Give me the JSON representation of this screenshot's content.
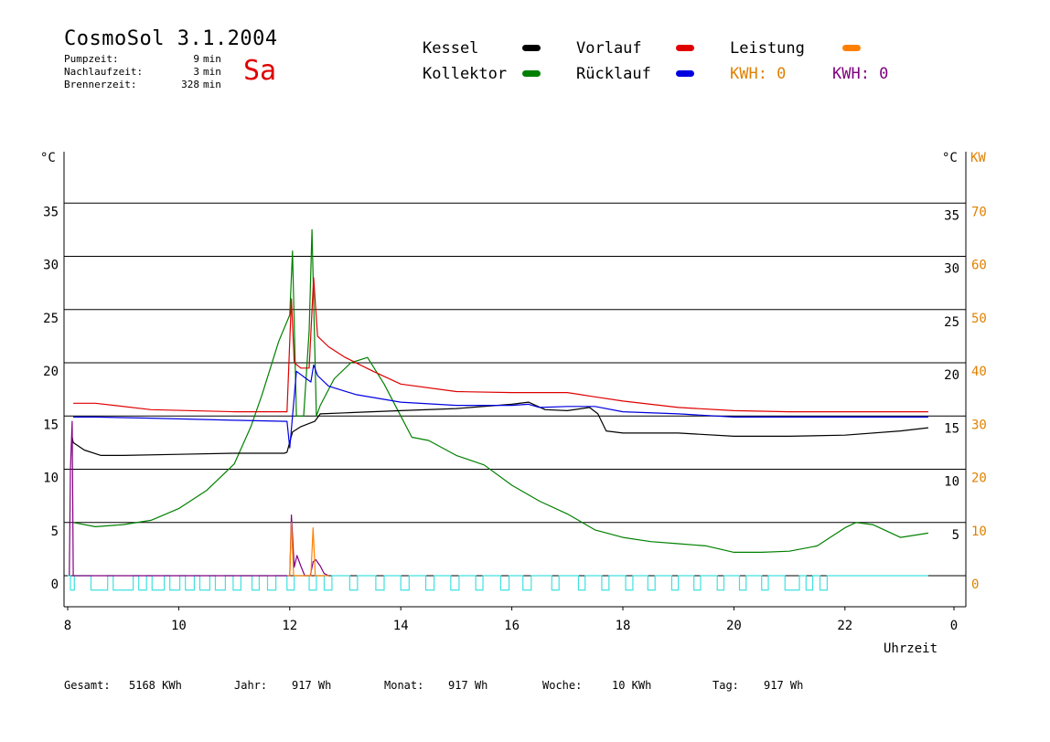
{
  "header": {
    "title": "CosmoSol 3.1.2004",
    "day": "Sa",
    "stats": [
      {
        "label": "Pumpzeit:",
        "value": "9",
        "unit": "min"
      },
      {
        "label": "Nachlaufzeit:",
        "value": "3",
        "unit": "min"
      },
      {
        "label": "Brennerzeit:",
        "value": "328",
        "unit": "min"
      }
    ]
  },
  "legend": {
    "kessel": "Kessel",
    "vorlauf": "Vorlauf",
    "leistung": "Leistung",
    "kollektor": "Kollektor",
    "ruecklauf": "Rücklauf",
    "kwh_orange": "KWH: 0",
    "kwh_purple": "KWH: 0"
  },
  "colors": {
    "kessel": "#000000",
    "vorlauf": "#e00000",
    "leistung": "#ff8000",
    "kollektor": "#008000",
    "ruecklauf": "#0000e0",
    "kwh_purple": "#800080",
    "pump": "#40e0e0",
    "axis_right_kw": "#e08000"
  },
  "axes": {
    "left_unit": "°C",
    "right_unit": "°C",
    "right_unit2": "KW",
    "xlabel": "Uhrzeit"
  },
  "footer": [
    {
      "label": "Gesamt:",
      "value": "5168 KWh"
    },
    {
      "label": "Jahr:",
      "value": "917 Wh"
    },
    {
      "label": "Monat:",
      "value": "917 Wh"
    },
    {
      "label": "Woche:",
      "value": "10 KWh"
    },
    {
      "label": "Tag:",
      "value": "917 Wh"
    }
  ],
  "chart_data": {
    "type": "line",
    "xlabel": "Uhrzeit",
    "ylabel": "°C",
    "xlim": [
      8,
      24
    ],
    "ylim": [
      0,
      40
    ],
    "y2lim": [
      0,
      80
    ],
    "y2label": "KW",
    "x_ticks": [
      "8",
      "10",
      "12",
      "14",
      "16",
      "18",
      "20",
      "22",
      "0"
    ],
    "y_ticks_left": [
      "0",
      "5",
      "10",
      "15",
      "20",
      "25",
      "30",
      "35"
    ],
    "y_ticks_right_c": [
      "5",
      "10",
      "15",
      "20",
      "25",
      "30",
      "35"
    ],
    "y_ticks_right_kw": [
      "0",
      "10",
      "20",
      "30",
      "40",
      "50",
      "60",
      "70"
    ],
    "grid": true,
    "series": [
      {
        "name": "Kessel",
        "key": "kessel",
        "x": [
          8.08,
          8.1,
          8.3,
          8.6,
          9,
          10,
          11,
          11.9,
          11.95,
          12.05,
          12.2,
          12.45,
          12.55,
          13,
          14,
          15,
          16,
          16.3,
          16.6,
          17,
          17.4,
          17.55,
          17.7,
          18,
          19,
          20,
          21,
          22,
          23,
          23.5
        ],
        "y": [
          13,
          12.5,
          11.8,
          11.3,
          11.3,
          11.4,
          11.5,
          11.5,
          11.6,
          13.5,
          14,
          14.5,
          15.2,
          15.3,
          15.5,
          15.7,
          16.1,
          16.3,
          15.6,
          15.5,
          15.8,
          15.2,
          13.6,
          13.4,
          13.4,
          13.1,
          13.1,
          13.2,
          13.6,
          13.9
        ]
      },
      {
        "name": "Vorlauf",
        "key": "vorlauf",
        "x": [
          8.1,
          8.5,
          9.5,
          11,
          11.95,
          12.03,
          12.08,
          12.2,
          12.35,
          12.43,
          12.5,
          12.7,
          13,
          13.5,
          14,
          15,
          16,
          17,
          17.5,
          18,
          19,
          20,
          21,
          22,
          23.5
        ],
        "y": [
          16.2,
          16.2,
          15.6,
          15.4,
          15.4,
          26,
          20,
          19.5,
          19.5,
          28,
          22.5,
          21.5,
          20.5,
          19.2,
          18,
          17.3,
          17.2,
          17.2,
          16.8,
          16.4,
          15.8,
          15.5,
          15.4,
          15.4,
          15.4
        ]
      },
      {
        "name": "Rücklauf",
        "key": "ruecklauf",
        "x": [
          8.1,
          8.5,
          9.5,
          11,
          11.95,
          12.0,
          12.12,
          12.3,
          12.38,
          12.43,
          12.5,
          12.7,
          13.2,
          14,
          15,
          16,
          16.3,
          16.5,
          17,
          17.5,
          18,
          19,
          20,
          21,
          22,
          23.5
        ],
        "y": [
          14.9,
          14.9,
          14.8,
          14.6,
          14.5,
          12,
          19.2,
          18.5,
          18.2,
          19.8,
          18.8,
          17.8,
          17,
          16.3,
          16,
          16,
          16.1,
          15.8,
          15.9,
          15.9,
          15.4,
          15.2,
          14.9,
          14.9,
          14.9,
          14.9
        ]
      },
      {
        "name": "Kollektor",
        "key": "kollektor",
        "x": [
          8.1,
          8.5,
          9.0,
          9.5,
          10,
          10.5,
          11,
          11.3,
          11.5,
          11.8,
          12.0,
          12.05,
          12.12,
          12.25,
          12.35,
          12.4,
          12.48,
          12.55,
          12.8,
          13.1,
          13.4,
          13.7,
          14,
          14.2,
          14.5,
          15,
          15.5,
          16,
          16.5,
          17,
          17.5,
          18,
          18.5,
          19,
          19.5,
          20,
          20.5,
          21,
          21.5,
          22,
          22.2,
          22.5,
          23,
          23.5
        ],
        "y": [
          5,
          4.6,
          4.8,
          5.2,
          6.3,
          8,
          10.5,
          14,
          17,
          22,
          24.5,
          30.5,
          15,
          15,
          23,
          32.5,
          15,
          16,
          18.5,
          20,
          20.5,
          18,
          15,
          13,
          12.7,
          11.3,
          10.4,
          8.5,
          7,
          5.8,
          4.3,
          3.6,
          3.2,
          3.0,
          2.8,
          2.2,
          2.2,
          2.3,
          2.8,
          4.5,
          5.0,
          4.8,
          3.6,
          4.0
        ]
      },
      {
        "name": "Leistung",
        "key": "leistung",
        "x": [
          11.95,
          12.0,
          12.03,
          12.07,
          12.12,
          12.3,
          12.38,
          12.42,
          12.46,
          12.5,
          12.7
        ],
        "y": [
          0,
          0,
          5,
          0,
          0,
          0,
          0,
          4.5,
          0,
          0,
          0
        ]
      },
      {
        "name": "KWH",
        "key": "kwh_purple",
        "x": [
          8.03,
          8.05,
          8.08,
          8.1,
          12.0,
          12.03,
          12.08,
          12.13,
          12.2,
          12.27,
          12.33,
          12.37,
          12.42,
          12.47,
          12.55,
          12.62,
          12.7
        ],
        "y": [
          0,
          10,
          14.5,
          0,
          0,
          5.7,
          0.8,
          1.9,
          0.9,
          0,
          0,
          0,
          1.3,
          1.5,
          0.9,
          0.2,
          0
        ]
      },
      {
        "name": "Pumpe",
        "key": "pump",
        "pulses": [
          [
            8.05,
            8.12
          ],
          [
            8.42,
            8.72
          ],
          [
            8.82,
            9.18
          ],
          [
            9.28,
            9.42
          ],
          [
            9.52,
            9.74
          ],
          [
            9.84,
            10.02
          ],
          [
            10.12,
            10.28
          ],
          [
            10.38,
            10.56
          ],
          [
            10.66,
            10.84
          ],
          [
            10.98,
            11.12
          ],
          [
            11.32,
            11.45
          ],
          [
            11.6,
            11.75
          ],
          [
            11.95,
            12.08
          ],
          [
            12.35,
            12.48
          ],
          [
            12.62,
            12.76
          ],
          [
            13.08,
            13.22
          ],
          [
            13.55,
            13.7
          ],
          [
            14.0,
            14.15
          ],
          [
            14.45,
            14.6
          ],
          [
            14.9,
            15.05
          ],
          [
            15.35,
            15.48
          ],
          [
            15.8,
            15.95
          ],
          [
            16.2,
            16.35
          ],
          [
            16.72,
            16.85
          ],
          [
            17.2,
            17.32
          ],
          [
            17.62,
            17.75
          ],
          [
            18.05,
            18.18
          ],
          [
            18.45,
            18.58
          ],
          [
            18.88,
            19.0
          ],
          [
            19.28,
            19.4
          ],
          [
            19.7,
            19.82
          ],
          [
            20.1,
            20.22
          ],
          [
            20.5,
            20.62
          ],
          [
            20.92,
            21.18
          ],
          [
            21.3,
            21.42
          ],
          [
            21.55,
            21.68
          ]
        ]
      }
    ]
  }
}
